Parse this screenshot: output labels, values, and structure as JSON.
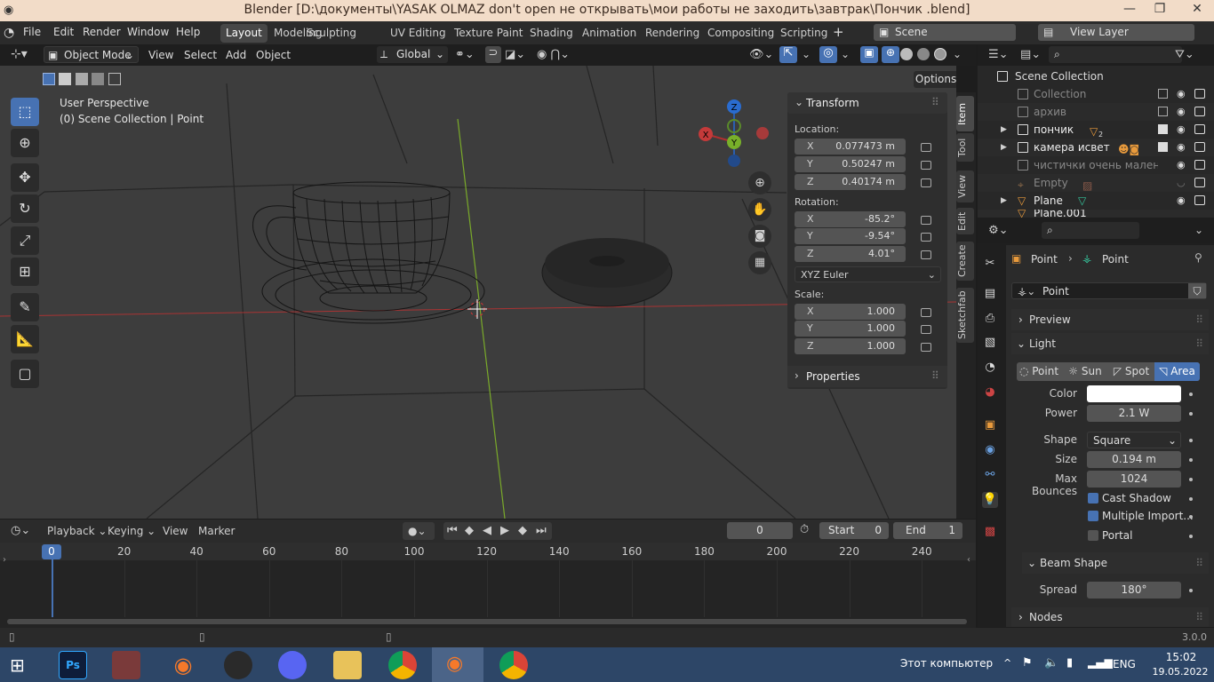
{
  "titlebar": {
    "title": "Blender [D:\\документы\\YASAK OLMAZ don't open не открывать\\мои работы не заходить\\завтрак\\Пончик  .blend]"
  },
  "menu": {
    "items": [
      "File",
      "Edit",
      "Render",
      "Window",
      "Help"
    ]
  },
  "workspaces": [
    "Layout",
    "Modeling",
    "Sculpting",
    "UV Editing",
    "Texture Paint",
    "Shading",
    "Animation",
    "Rendering",
    "Compositing",
    "Scripting"
  ],
  "active_workspace": "Layout",
  "scene_field": "Scene",
  "view_layer_field": "View Layer",
  "viewport_header": {
    "mode": "Object Mode",
    "view": "View",
    "select": "Select",
    "add": "Add",
    "object": "Object",
    "orientation": "Global",
    "options": "Options"
  },
  "viewport": {
    "perspective": "User Perspective",
    "collection": "(0) Scene Collection | Point"
  },
  "gizmo": {
    "x": "X",
    "y": "Y",
    "z": "Z"
  },
  "npanel": {
    "transform": "Transform",
    "location_label": "Location:",
    "location": [
      {
        "axis": "X",
        "value": "0.077473 m"
      },
      {
        "axis": "Y",
        "value": "0.50247 m"
      },
      {
        "axis": "Z",
        "value": "0.40174 m"
      }
    ],
    "rotation_label": "Rotation:",
    "rotation": [
      {
        "axis": "X",
        "value": "-85.2°"
      },
      {
        "axis": "Y",
        "value": "-9.54°"
      },
      {
        "axis": "Z",
        "value": "4.01°"
      }
    ],
    "rotation_mode": "XYZ Euler",
    "scale_label": "Scale:",
    "scale": [
      {
        "axis": "X",
        "value": "1.000"
      },
      {
        "axis": "Y",
        "value": "1.000"
      },
      {
        "axis": "Z",
        "value": "1.000"
      }
    ],
    "properties": "Properties"
  },
  "side_tabs": [
    "Item",
    "Tool",
    "View",
    "Edit",
    "Create",
    "Sketchfab"
  ],
  "outliner": {
    "root": "Scene Collection",
    "rows": [
      {
        "name": "Collection"
      },
      {
        "name": "архив"
      },
      {
        "name": "пончик",
        "badge": "2"
      },
      {
        "name": "камера исвет"
      },
      {
        "name": "чистички очень маленьк"
      },
      {
        "name": "Empty"
      },
      {
        "name": "Plane"
      },
      {
        "name": "Plane.001"
      }
    ]
  },
  "properties": {
    "breadcrumb_a": "Point",
    "breadcrumb_b": "Point",
    "datablock": "Point",
    "preview": "Preview",
    "light": "Light",
    "light_types": [
      "Point",
      "Sun",
      "Spot",
      "Area"
    ],
    "active_light_type": "Area",
    "color_label": "Color",
    "color_value": "#ffffff",
    "power_label": "Power",
    "power": "2.1 W",
    "shape_label": "Shape",
    "shape": "Square",
    "size_label": "Size",
    "size": "0.194 m",
    "bounces_label": "Max Bounces",
    "bounces": "1024",
    "cast_shadow": "Cast Shadow",
    "multiple_importance": "Multiple Import...",
    "portal": "Portal",
    "beam_shape": "Beam Shape",
    "spread_label": "Spread",
    "spread": "180°",
    "nodes": "Nodes"
  },
  "timeline": {
    "playback": "Playback",
    "keying": "Keying",
    "view": "View",
    "marker": "Marker",
    "current_frame": "0",
    "start_label": "Start",
    "start": "0",
    "end_label": "End",
    "end": "1",
    "ticks": [
      "0",
      "20",
      "40",
      "60",
      "80",
      "100",
      "120",
      "140",
      "160",
      "180",
      "200",
      "220",
      "240"
    ]
  },
  "statusbar": {
    "version": "3.0.0"
  },
  "taskbar": {
    "computer": "Этот компьютер",
    "lang": "ENG",
    "time": "15:02",
    "date": "19.05.2022",
    "ps": "Ps"
  }
}
